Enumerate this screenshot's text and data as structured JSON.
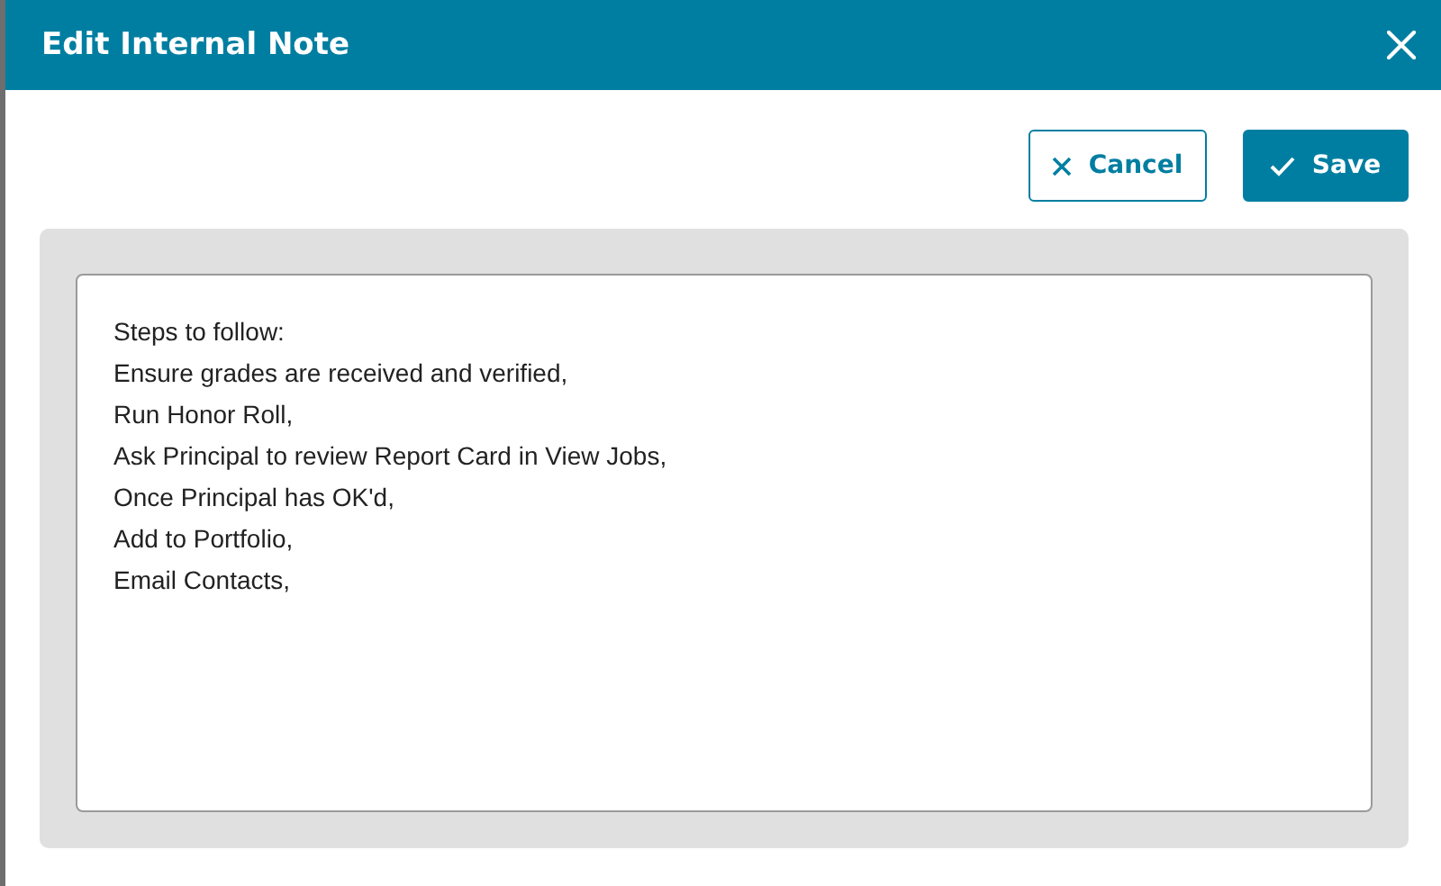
{
  "dialog": {
    "title": "Edit Internal Note"
  },
  "buttons": [
    {
      "kind": "cancel",
      "label": "Cancel"
    },
    {
      "kind": "save",
      "label": "Save"
    }
  ],
  "note": {
    "lines": [
      "Steps to follow:",
      "Ensure grades are received and verified,",
      "Run Honor Roll,",
      "Ask Principal to review Report Card in View Jobs,",
      "Once Principal has OK'd,",
      "Add to Portfolio,",
      "Email Contacts,"
    ]
  }
}
